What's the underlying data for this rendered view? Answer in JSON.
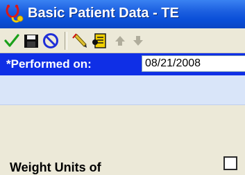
{
  "window": {
    "title": "Basic Patient Data - TE",
    "icon": "app-stethoscope-icon"
  },
  "toolbar": {
    "buttons": [
      {
        "name": "sign-check-icon",
        "color": "#1aa11a"
      },
      {
        "name": "save-disk-icon",
        "color": "#000000"
      },
      {
        "name": "cancel-icon",
        "color": "#1f2fd8"
      },
      {
        "name": "pencil-edit-icon",
        "color": "#c9a400"
      },
      {
        "name": "notes-icon",
        "color": "#d8b400"
      },
      {
        "name": "arrow-up-icon",
        "color": "#b0ad9c"
      },
      {
        "name": "arrow-down-icon",
        "color": "#b0ad9c"
      }
    ]
  },
  "performed": {
    "label": "*Performed on:",
    "date": "08/21/2008"
  },
  "section": {
    "label": "Weight  Units of"
  },
  "colors": {
    "title_bar": "#0a4fd8",
    "performed_bar": "#0f2fe6",
    "info_strip": "#d9e5f9"
  }
}
